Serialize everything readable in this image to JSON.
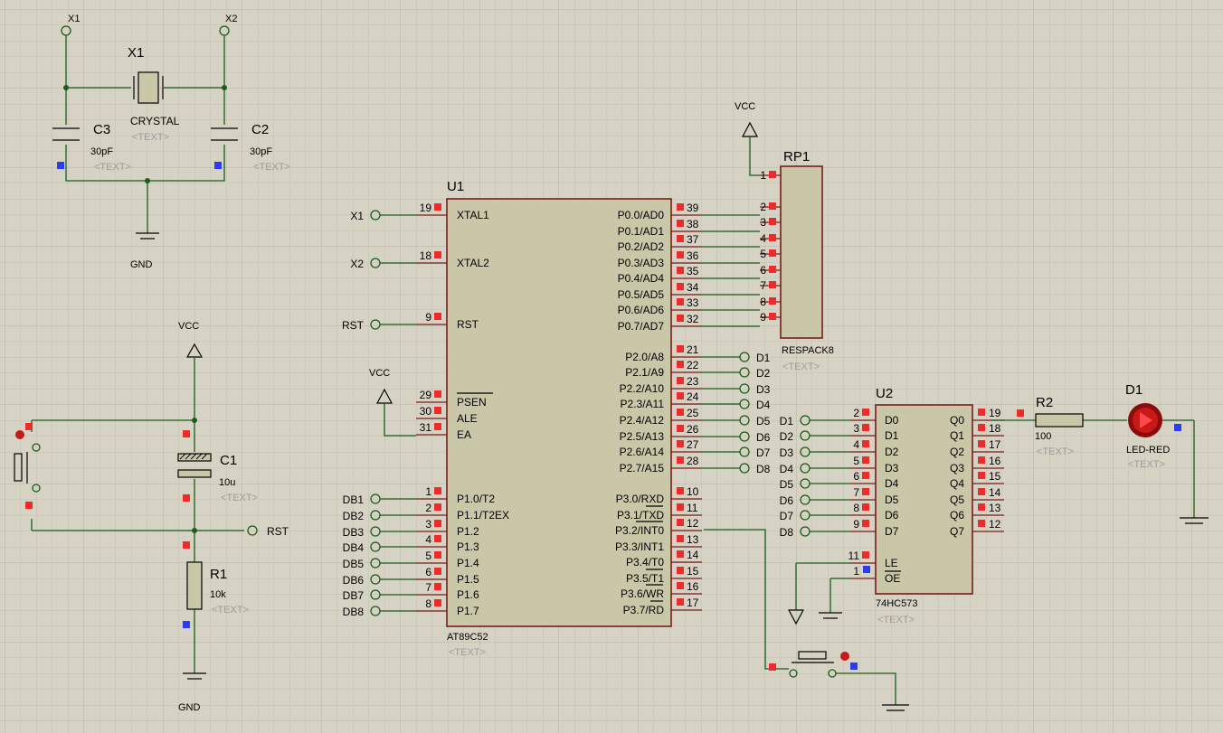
{
  "colors": {
    "grid_bg": "#d6d3c4",
    "wire": "#1a5c1a",
    "component_body": "#c9c7a8",
    "component_border": "#7a1c1c",
    "pin_marker": "#ee2b2b",
    "unconnected_marker": "#2b3dee"
  },
  "crystal_circuit": {
    "term_x1": "X1",
    "term_x2": "X2",
    "crystal_ref": "X1",
    "crystal_value": "CRYSTAL",
    "crystal_text": "<TEXT>",
    "c3_ref": "C3",
    "c3_value": "30pF",
    "c3_text": "<TEXT>",
    "c2_ref": "C2",
    "c2_value": "30pF",
    "c2_text": "<TEXT>",
    "gnd": "GND"
  },
  "reset_circuit": {
    "vcc": "VCC",
    "c1_ref": "C1",
    "c1_value": "10u",
    "c1_text": "<TEXT>",
    "rst": "RST",
    "r1_ref": "R1",
    "r1_value": "10k",
    "r1_text": "<TEXT>",
    "gnd": "GND"
  },
  "mcu": {
    "ref": "U1",
    "part": "AT89C52",
    "text": "<TEXT>",
    "left_pins": [
      {
        "num": "19",
        "name": "XTAL1",
        "net": "X1"
      },
      {
        "num": "18",
        "name": "XTAL2",
        "net": "X2"
      },
      {
        "num": "9",
        "name": "RST",
        "net": "RST"
      },
      {
        "num": "29",
        "name": "PSEN",
        "net": ""
      },
      {
        "num": "30",
        "name": "ALE",
        "net": ""
      },
      {
        "num": "31",
        "name": "EA",
        "net": ""
      },
      {
        "num": "1",
        "name": "P1.0/T2",
        "net": "DB1"
      },
      {
        "num": "2",
        "name": "P1.1/T2EX",
        "net": "DB2"
      },
      {
        "num": "3",
        "name": "P1.2",
        "net": "DB3"
      },
      {
        "num": "4",
        "name": "P1.3",
        "net": "DB4"
      },
      {
        "num": "5",
        "name": "P1.4",
        "net": "DB5"
      },
      {
        "num": "6",
        "name": "P1.5",
        "net": "DB6"
      },
      {
        "num": "7",
        "name": "P1.6",
        "net": "DB7"
      },
      {
        "num": "8",
        "name": "P1.7",
        "net": "DB8"
      }
    ],
    "vcc_ea": "VCC",
    "p0_pins": [
      {
        "num": "39",
        "name": "P0.0/AD0"
      },
      {
        "num": "38",
        "name": "P0.1/AD1"
      },
      {
        "num": "37",
        "name": "P0.2/AD2"
      },
      {
        "num": "36",
        "name": "P0.3/AD3"
      },
      {
        "num": "35",
        "name": "P0.4/AD4"
      },
      {
        "num": "34",
        "name": "P0.5/AD5"
      },
      {
        "num": "33",
        "name": "P0.6/AD6"
      },
      {
        "num": "32",
        "name": "P0.7/AD7"
      }
    ],
    "p2_pins": [
      {
        "num": "21",
        "name": "P2.0/A8",
        "net": "D1"
      },
      {
        "num": "22",
        "name": "P2.1/A9",
        "net": "D2"
      },
      {
        "num": "23",
        "name": "P2.2/A10",
        "net": "D3"
      },
      {
        "num": "24",
        "name": "P2.3/A11",
        "net": "D4"
      },
      {
        "num": "25",
        "name": "P2.4/A12",
        "net": "D5"
      },
      {
        "num": "26",
        "name": "P2.5/A13",
        "net": "D6"
      },
      {
        "num": "27",
        "name": "P2.6/A14",
        "net": "D7"
      },
      {
        "num": "28",
        "name": "P2.7/A15",
        "net": "D8"
      }
    ],
    "p3_pins": [
      {
        "num": "10",
        "name": "P3.0/RXD"
      },
      {
        "num": "11",
        "name": "P3.1/TXD"
      },
      {
        "num": "12",
        "name": "P3.2/INT0"
      },
      {
        "num": "13",
        "name": "P3.3/INT1"
      },
      {
        "num": "14",
        "name": "P3.4/T0"
      },
      {
        "num": "15",
        "name": "P3.5/T1"
      },
      {
        "num": "16",
        "name": "P3.6/WR"
      },
      {
        "num": "17",
        "name": "P3.7/RD"
      }
    ]
  },
  "respack": {
    "ref": "RP1",
    "part": "RESPACK8",
    "text": "<TEXT>",
    "vcc": "VCC",
    "pins": [
      "1",
      "2",
      "3",
      "4",
      "5",
      "6",
      "7",
      "8",
      "9"
    ]
  },
  "latch": {
    "ref": "U2",
    "part": "74HC573",
    "text": "<TEXT>",
    "d_pins": [
      {
        "num": "2",
        "name": "D0",
        "net": "D1"
      },
      {
        "num": "3",
        "name": "D1",
        "net": "D2"
      },
      {
        "num": "4",
        "name": "D2",
        "net": "D3"
      },
      {
        "num": "5",
        "name": "D3",
        "net": "D4"
      },
      {
        "num": "6",
        "name": "D4",
        "net": "D5"
      },
      {
        "num": "7",
        "name": "D5",
        "net": "D6"
      },
      {
        "num": "8",
        "name": "D6",
        "net": "D7"
      },
      {
        "num": "9",
        "name": "D7",
        "net": "D8"
      }
    ],
    "q_pins": [
      {
        "num": "19",
        "name": "Q0"
      },
      {
        "num": "18",
        "name": "Q1"
      },
      {
        "num": "17",
        "name": "Q2"
      },
      {
        "num": "16",
        "name": "Q3"
      },
      {
        "num": "15",
        "name": "Q4"
      },
      {
        "num": "14",
        "name": "Q5"
      },
      {
        "num": "13",
        "name": "Q6"
      },
      {
        "num": "12",
        "name": "Q7"
      }
    ],
    "le_num": "11",
    "le_name": "LE",
    "oe_num": "1",
    "oe_name": "OE"
  },
  "output": {
    "r2_ref": "R2",
    "r2_value": "100",
    "r2_text": "<TEXT>",
    "d1_ref": "D1",
    "d1_part": "LED-RED",
    "d1_text": "<TEXT>"
  }
}
